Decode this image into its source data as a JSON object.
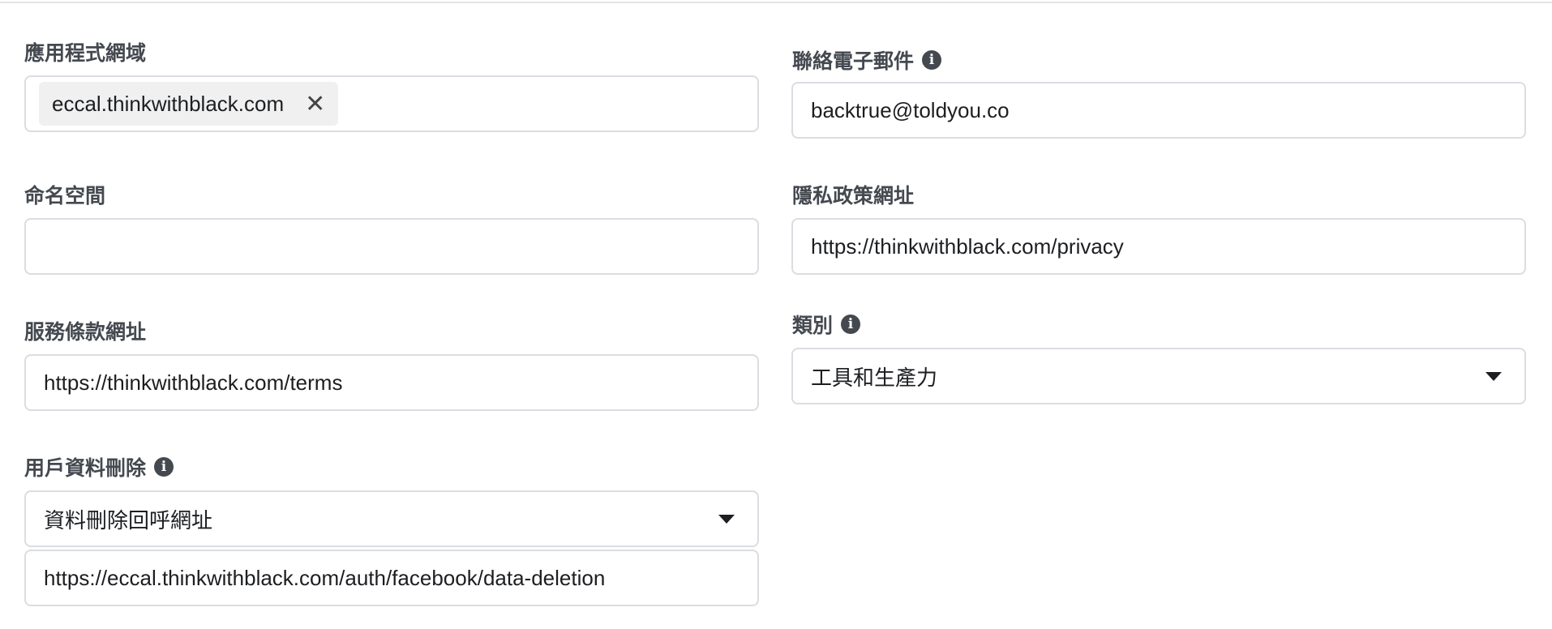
{
  "fields": {
    "app_domains": {
      "label": "應用程式網域",
      "chips": [
        "eccal.thinkwithblack.com"
      ]
    },
    "contact_email": {
      "label": "聯絡電子郵件",
      "value": "backtrue@toldyou.co",
      "icon": "info-icon"
    },
    "namespace": {
      "label": "命名空間",
      "value": ""
    },
    "privacy_url": {
      "label": "隱私政策網址",
      "value": "https://thinkwithblack.com/privacy"
    },
    "terms_url": {
      "label": "服務條款網址",
      "value": "https://thinkwithblack.com/terms"
    },
    "category": {
      "label": "類別",
      "selected": "工具和生產力",
      "icon": "info-icon"
    },
    "data_deletion": {
      "label": "用戶資料刪除",
      "selected": "資料刪除回呼網址",
      "value": "https://eccal.thinkwithblack.com/auth/facebook/data-deletion",
      "icon": "info-icon"
    }
  },
  "info_glyph": "i"
}
